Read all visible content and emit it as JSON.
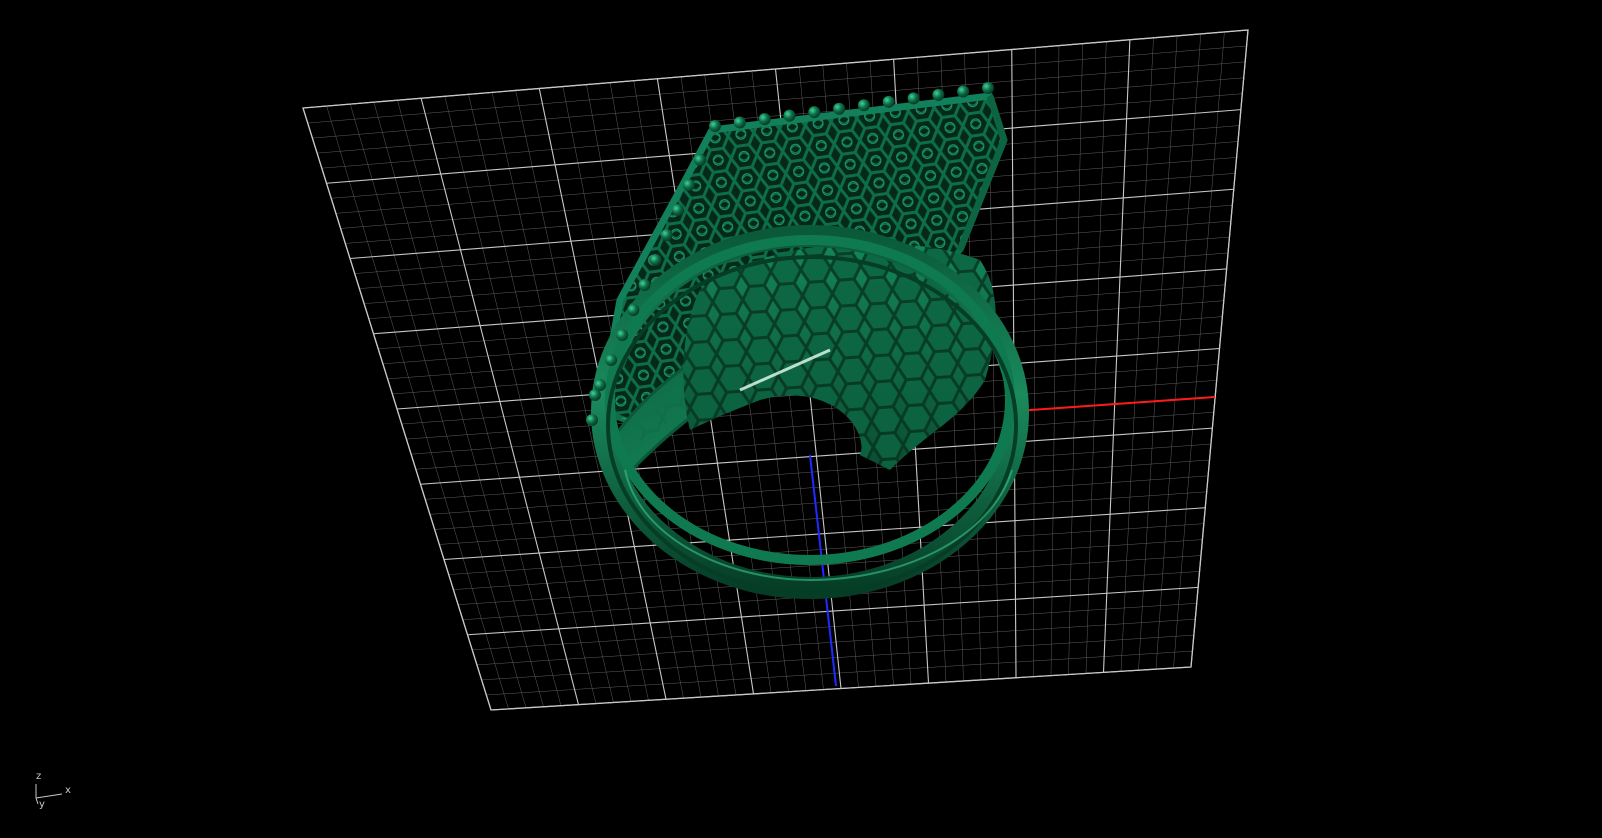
{
  "viewport": {
    "background_color": "#000000",
    "grid_color": "#c8c8c8",
    "minor_grid_color": "#5e5e5e",
    "x_axis_color": "#ff1a1a",
    "y_axis_color": "#1f2bff",
    "model_color": "#0e6e48",
    "model_highlight_color": "#2fbf86",
    "model_shadow_color": "#063d27"
  },
  "axis_triad": {
    "z_label": "z",
    "x_label": "x",
    "y_label": "y"
  }
}
